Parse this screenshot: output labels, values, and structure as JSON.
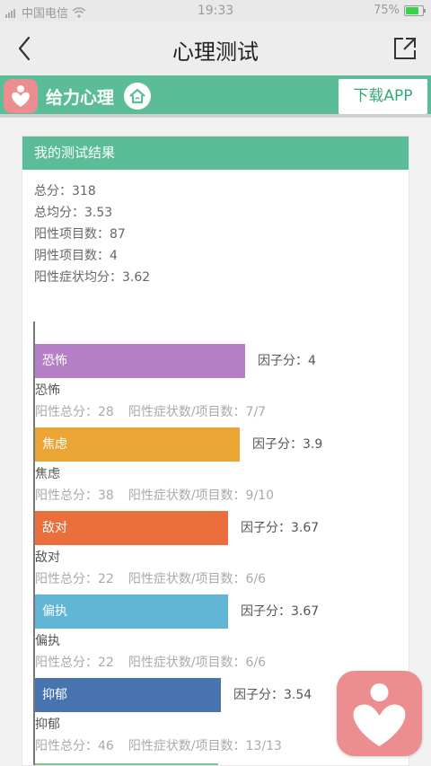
{
  "status_bar": {
    "carrier": "中国电信",
    "time": "19:33",
    "battery_text": "75%",
    "battery_level": 0.75
  },
  "nav": {
    "title": "心理测试",
    "back_icon": "chevron-left-icon",
    "share_icon": "share-icon"
  },
  "banner": {
    "app_name": "给力心理",
    "home_icon": "home-icon",
    "download_label": "下载APP",
    "color": "#5bbd98"
  },
  "card": {
    "header": "我的测试结果",
    "summary": [
      "总分：318",
      "总均分：3.53",
      "阳性项目数：87",
      "阴性项目数：4",
      "阳性症状均分：3.62"
    ]
  },
  "factors": [
    {
      "name": "恐怖",
      "score_text": "因子分：4",
      "score": 4,
      "positive_total": "阳性总分：28",
      "ratio": "阳性症状数/项目数：7/7",
      "color": "#b57fc6"
    },
    {
      "name": "焦虑",
      "score_text": "因子分：3.9",
      "score": 3.9,
      "positive_total": "阳性总分：38",
      "ratio": "阳性症状数/项目数：9/10",
      "color": "#eaa534"
    },
    {
      "name": "敌对",
      "score_text": "因子分：3.67",
      "score": 3.67,
      "positive_total": "阳性总分：22",
      "ratio": "阳性症状数/项目数：6/6",
      "color": "#ea6f3c"
    },
    {
      "name": "偏执",
      "score_text": "因子分：3.67",
      "score": 3.67,
      "positive_total": "阳性总分：22",
      "ratio": "阳性症状数/项目数：6/6",
      "color": "#62b6d5"
    },
    {
      "name": "抑郁",
      "score_text": "因子分：3.54",
      "score": 3.54,
      "positive_total": "阳性总分：46",
      "ratio": "阳性症状数/项目数：13/13",
      "color": "#4774ae"
    }
  ],
  "floating_icon": "heart-person-icon"
}
